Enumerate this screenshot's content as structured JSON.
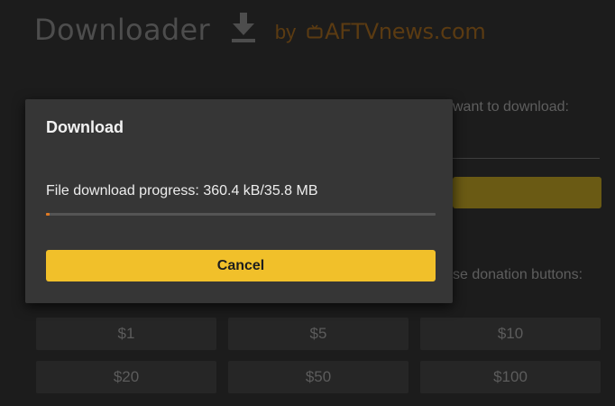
{
  "app": {
    "title": "Downloader",
    "icon": "download-icon",
    "byline": "by",
    "brand": "AFTVnews.com",
    "brand_icon": "tv-icon",
    "url_prompt": "want to download:",
    "donation_prompt": "se donation buttons:"
  },
  "donations": [
    "$1",
    "$5",
    "$10",
    "$20",
    "$50",
    "$100"
  ],
  "dialog": {
    "title": "Download",
    "progress_text": "File download progress: 360.4 kB/35.8 MB",
    "progress_fraction": 0.0098,
    "cancel_label": "Cancel"
  },
  "colors": {
    "accent": "#f1c02a",
    "progress": "#e07a22",
    "dialog_bg": "#363636"
  }
}
